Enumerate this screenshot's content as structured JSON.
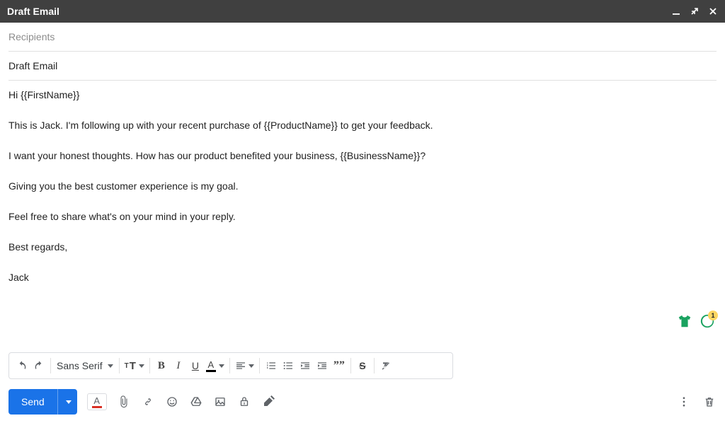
{
  "window": {
    "title": "Draft Email"
  },
  "fields": {
    "recipients_placeholder": "Recipients",
    "subject": "Draft Email"
  },
  "body": {
    "p1": "Hi {{FirstName}}",
    "p2": "This is Jack. I'm following up with your recent purchase of {{ProductName}} to get your feedback.",
    "p3": "I want your honest thoughts.  How has our product benefited your business, {{BusinessName}}?",
    "p4": "Giving you the best customer experience is my goal.",
    "p5": "Feel free to share what's on your mind in your reply.",
    "p6": "Best regards,",
    "p7": "Jack"
  },
  "toolbar": {
    "font_family": "Sans Serif",
    "send_label": "Send"
  },
  "extension": {
    "badge_count": "1"
  }
}
